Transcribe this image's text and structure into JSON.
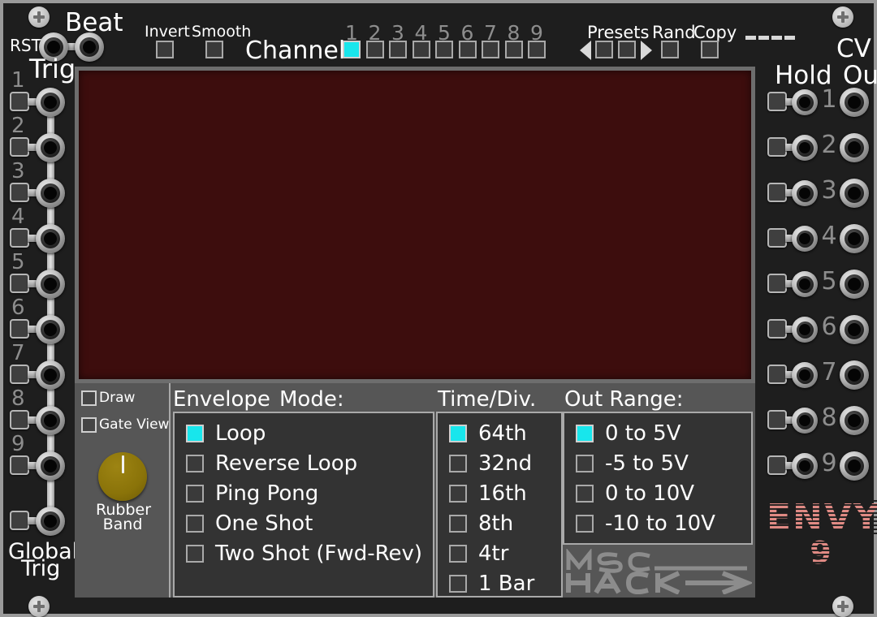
{
  "module": {
    "brand_line1": "ENVY",
    "brand_line2": "9",
    "maker_line1": "MSC",
    "maker_line2": "HACK",
    "preset_indicator": "----",
    "accent_color": "#18e6ec",
    "screen_color": "#3d0d0d",
    "panel_color": "#1e1e1e",
    "knob_color": "#8a7309",
    "brand_color": "#e08a84"
  },
  "top": {
    "rst_label": "RST",
    "beat_label": "Beat",
    "trig_label": "Trig",
    "invert_label": "Invert",
    "smooth_label": "Smooth",
    "channel_label": "Channel",
    "channel_numbers": [
      "1",
      "2",
      "3",
      "4",
      "5",
      "6",
      "7",
      "8",
      "9"
    ],
    "channel_selected": 1,
    "presets_label": "Presets",
    "rand_label": "Rand",
    "copy_label": "Copy"
  },
  "left": {
    "trig_numbers": [
      "1",
      "2",
      "3",
      "4",
      "5",
      "6",
      "7",
      "8",
      "9"
    ],
    "global_line1": "Global",
    "global_line2": "Trig"
  },
  "right": {
    "hold_label": "Hold",
    "cv_label": "CV",
    "out_label": "Out",
    "channel_numbers": [
      "1",
      "2",
      "3",
      "4",
      "5",
      "6",
      "7",
      "8",
      "9"
    ]
  },
  "sidebar": {
    "draw_label": "Draw",
    "draw_checked": false,
    "gate_view_label": "Gate View",
    "gate_view_checked": false,
    "knob_label_line1": "Rubber",
    "knob_label_line2": "Band"
  },
  "envelope_mode": {
    "heading_a": "Envelope",
    "heading_b": "Mode:",
    "options": [
      {
        "label": "Loop",
        "selected": true
      },
      {
        "label": "Reverse Loop",
        "selected": false
      },
      {
        "label": "Ping Pong",
        "selected": false
      },
      {
        "label": "One Shot",
        "selected": false
      },
      {
        "label": "Two Shot (Fwd-Rev)",
        "selected": false
      }
    ]
  },
  "time_div": {
    "heading": "Time/Div.",
    "options": [
      {
        "label": "64th",
        "selected": true
      },
      {
        "label": "32nd",
        "selected": false
      },
      {
        "label": "16th",
        "selected": false
      },
      {
        "label": "8th",
        "selected": false
      },
      {
        "label": "4tr",
        "selected": false
      },
      {
        "label": "1 Bar",
        "selected": false
      }
    ]
  },
  "out_range": {
    "heading": "Out Range:",
    "options": [
      {
        "label": "0 to 5V",
        "selected": true
      },
      {
        "label": "-5 to 5V",
        "selected": false
      },
      {
        "label": "0 to 10V",
        "selected": false
      },
      {
        "label": "-10 to 10V",
        "selected": false
      }
    ]
  }
}
